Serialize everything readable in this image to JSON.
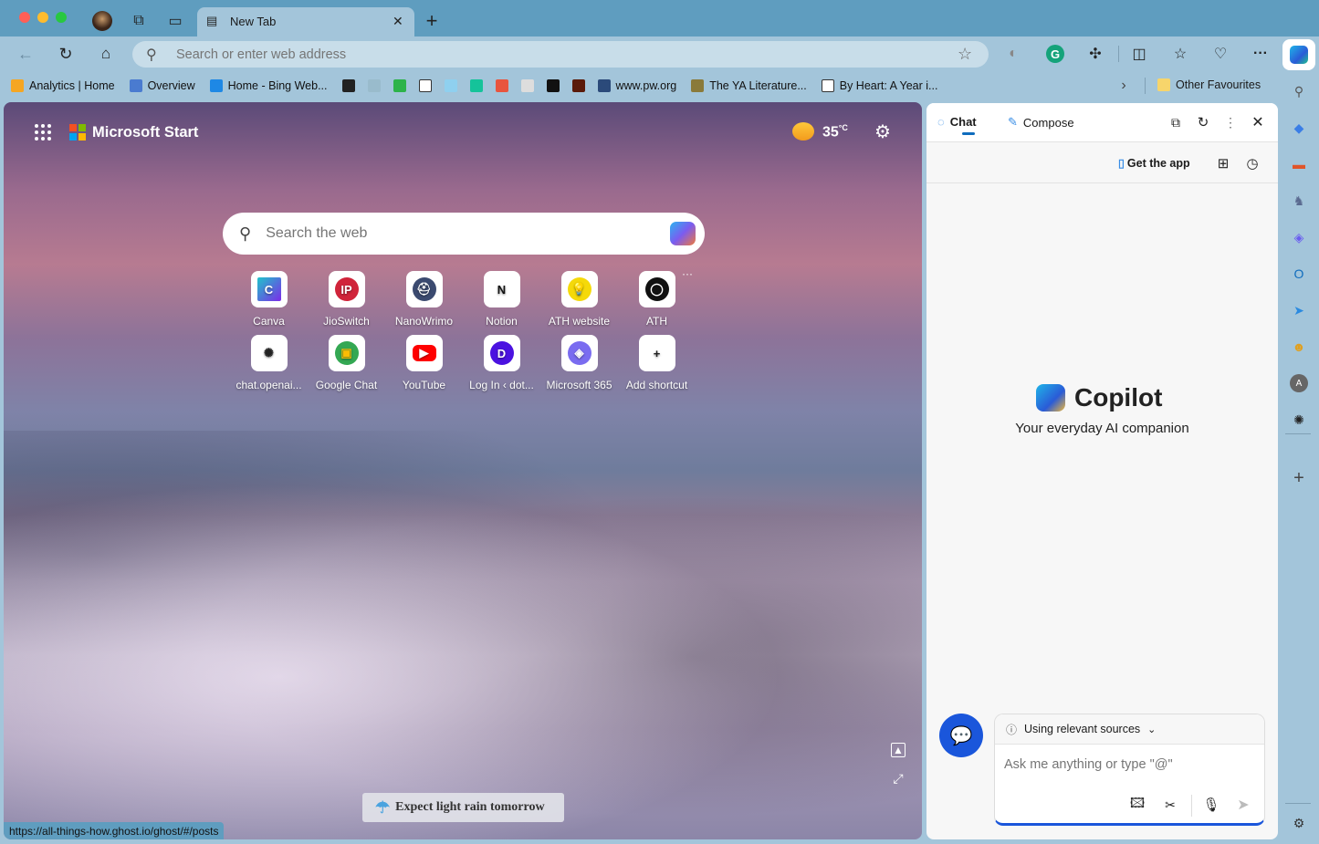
{
  "window": {
    "colors": {
      "close": "#ff5f57",
      "minimize": "#febc2e",
      "maximize": "#28c840"
    }
  },
  "tab": {
    "title": "New Tab"
  },
  "address_bar": {
    "placeholder": "Search or enter web address"
  },
  "bookmarks": [
    {
      "label": "Analytics | Home",
      "icon": "analytics-icon",
      "color": "#f5a623"
    },
    {
      "label": "Overview",
      "icon": "overview-icon",
      "color": "#4a7bd0"
    },
    {
      "label": "Home - Bing Web...",
      "icon": "bing-icon",
      "color": "#1e88e5"
    },
    {
      "label": "",
      "icon": "bookmark-dark-icon",
      "color": "#222"
    },
    {
      "label": "",
      "icon": "bookmark-h-icon",
      "color": "#9bc"
    },
    {
      "label": "",
      "icon": "ok-icon",
      "color": "#2db34a"
    },
    {
      "label": "",
      "icon": "document-icon",
      "color": "#fff"
    },
    {
      "label": "",
      "icon": "at-icon",
      "color": "#8fd0ef"
    },
    {
      "label": "",
      "icon": "grammarly-icon",
      "color": "#15c39a"
    },
    {
      "label": "",
      "icon": "asterisk-icon",
      "color": "#e8553e"
    },
    {
      "label": "",
      "icon": "bw-icon",
      "color": "#ddd"
    },
    {
      "label": "",
      "icon": "notion-icon",
      "color": "#111"
    },
    {
      "label": "",
      "icon": "image-bookmark-icon",
      "color": "#5a1a0a"
    },
    {
      "label": "www.pw.org",
      "icon": "pw-icon",
      "color": "#2b4a7a"
    },
    {
      "label": "The YA Literature...",
      "icon": "ya-icon",
      "color": "#8a7a3a"
    },
    {
      "label": "By Heart: A Year i...",
      "icon": "document-icon",
      "color": "#fff"
    }
  ],
  "other_favourites": "Other Favourites",
  "ntp": {
    "brand": "Microsoft Start",
    "weather": {
      "temp": "35",
      "unit": "°C"
    },
    "search_placeholder": "Search the web",
    "shortcuts": [
      {
        "label": "Canva",
        "glyph": "C",
        "bg": "#3fbbd6",
        "fg": "#fff"
      },
      {
        "label": "JioSwitch",
        "glyph": "IP",
        "bg": "#d0243a",
        "fg": "#fff"
      },
      {
        "label": "NanoWrimo",
        "glyph": "⛑",
        "bg": "#3b4a70",
        "fg": "#fff"
      },
      {
        "label": "Notion",
        "glyph": "N",
        "bg": "#fff",
        "fg": "#111"
      },
      {
        "label": "ATH website",
        "glyph": "💡",
        "bg": "#f5d90a",
        "fg": "#111"
      },
      {
        "label": "ATH",
        "glyph": "◯",
        "bg": "#111",
        "fg": "#fff"
      },
      {
        "label": "chat.openai...",
        "glyph": "✺",
        "bg": "#fff",
        "fg": "#222"
      },
      {
        "label": "Google Chat",
        "glyph": "▣",
        "bg": "#34a853",
        "fg": "#fbbc04"
      },
      {
        "label": "YouTube",
        "glyph": "▶",
        "bg": "#ff0000",
        "fg": "#fff"
      },
      {
        "label": "Log In ‹ dot...",
        "glyph": "D",
        "bg": "#4b12e0",
        "fg": "#fff"
      },
      {
        "label": "Microsoft 365",
        "glyph": "◈",
        "bg": "#7a6cf0",
        "fg": "#fff"
      },
      {
        "label": "Add shortcut",
        "glyph": "+",
        "bg": "#fff",
        "fg": "#222"
      }
    ],
    "weather_banner": "Expect light rain tomorrow",
    "status_url": "https://all-things-how.ghost.io/ghost/#/posts"
  },
  "copilot": {
    "tabs": [
      {
        "label": "Chat",
        "active": true
      },
      {
        "label": "Compose",
        "active": false
      }
    ],
    "get_app": "Get the app",
    "title": "Copilot",
    "subtitle": "Your everyday AI companion",
    "sources": "Using relevant sources",
    "input_placeholder": "Ask me anything or type \"@\"",
    "accent": "#1a56db"
  },
  "right_sidebar": [
    "search-icon",
    "tag-icon",
    "toolbox-icon",
    "games-icon",
    "copilot-icon",
    "outlook-icon",
    "telegram-icon",
    "character-icon",
    "avatar-a-icon",
    "openai-icon",
    "add-icon",
    "settings-icon"
  ]
}
